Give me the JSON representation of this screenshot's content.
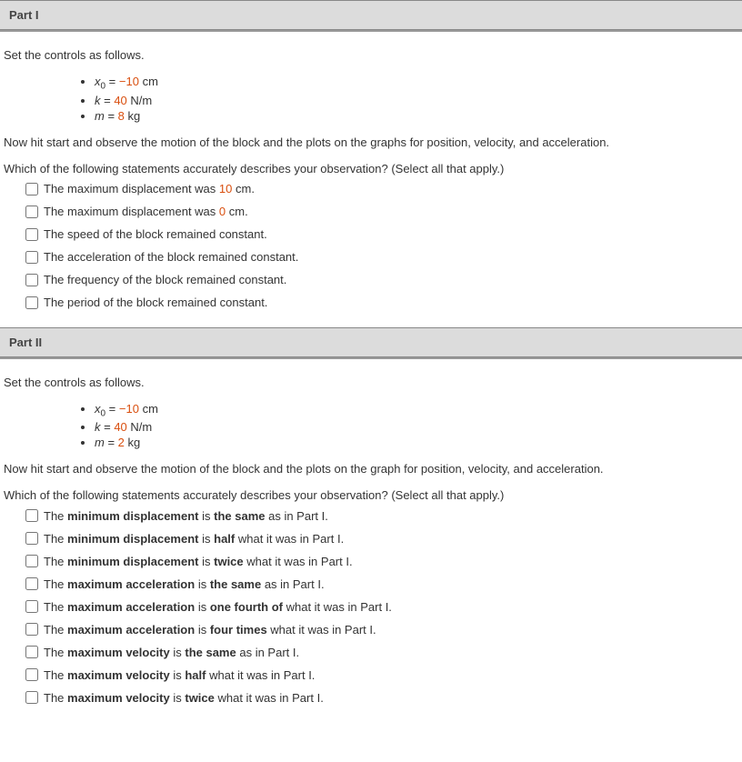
{
  "part1": {
    "title": "Part I",
    "set_controls": "Set the controls as follows.",
    "controls": {
      "x0_var": "x",
      "x0_sub": "0",
      "x0_eq": " = ",
      "x0_val": "−10",
      "x0_unit": " cm",
      "k_var": "k",
      "k_eq": " = ",
      "k_val": "40",
      "k_unit": " N/m",
      "m_var": "m",
      "m_eq": " = ",
      "m_val": "8",
      "m_unit": " kg"
    },
    "hit_start": "Now hit start and observe the motion of the block and the plots on the graphs for position, velocity, and acceleration.",
    "question": "Which of the following statements accurately describes your observation? (Select all that apply.)",
    "opt1_a": "The maximum displacement was ",
    "opt1_b": "10",
    "opt1_c": " cm.",
    "opt2_a": "The maximum displacement was ",
    "opt2_b": "0",
    "opt2_c": " cm.",
    "opt3": "The speed of the block remained constant.",
    "opt4": "The acceleration of the block remained constant.",
    "opt5": "The frequency of the block remained constant.",
    "opt6": "The period of the block remained constant."
  },
  "part2": {
    "title": "Part II",
    "set_controls": "Set the controls as follows.",
    "controls": {
      "x0_var": "x",
      "x0_sub": "0",
      "x0_eq": " = ",
      "x0_val": "−10",
      "x0_unit": " cm",
      "k_var": "k",
      "k_eq": " = ",
      "k_val": "40",
      "k_unit": " N/m",
      "m_var": "m",
      "m_eq": " = ",
      "m_val": "2",
      "m_unit": " kg"
    },
    "hit_start": "Now hit start and observe the motion of the block and the plots on the graph for position, velocity, and acceleration.",
    "question": "Which of the following statements accurately describes your observation? (Select all that apply.)",
    "opt1_a": "The ",
    "opt1_b": "minimum displacement",
    "opt1_c": " is ",
    "opt1_d": "the same",
    "opt1_e": " as in Part I.",
    "opt2_a": "The ",
    "opt2_b": "minimum displacement",
    "opt2_c": " is ",
    "opt2_d": "half",
    "opt2_e": " what it was in Part I.",
    "opt3_a": "The ",
    "opt3_b": "minimum displacement",
    "opt3_c": " is ",
    "opt3_d": "twice",
    "opt3_e": " what it was in Part I.",
    "opt4_a": "The ",
    "opt4_b": "maximum acceleration",
    "opt4_c": " is ",
    "opt4_d": "the same",
    "opt4_e": " as in Part I.",
    "opt5_a": "The ",
    "opt5_b": "maximum acceleration",
    "opt5_c": " is ",
    "opt5_d": "one fourth of",
    "opt5_e": " what it was in Part I.",
    "opt6_a": "The ",
    "opt6_b": "maximum acceleration",
    "opt6_c": " is ",
    "opt6_d": "four times",
    "opt6_e": " what it was in Part I.",
    "opt7_a": "The ",
    "opt7_b": "maximum velocity",
    "opt7_c": " is ",
    "opt7_d": "the same",
    "opt7_e": " as in Part I.",
    "opt8_a": "The ",
    "opt8_b": "maximum velocity",
    "opt8_c": " is ",
    "opt8_d": "half",
    "opt8_e": " what it was in Part I.",
    "opt9_a": "The ",
    "opt9_b": "maximum velocity",
    "opt9_c": " is ",
    "opt9_d": "twice",
    "opt9_e": " what it was in Part I."
  }
}
